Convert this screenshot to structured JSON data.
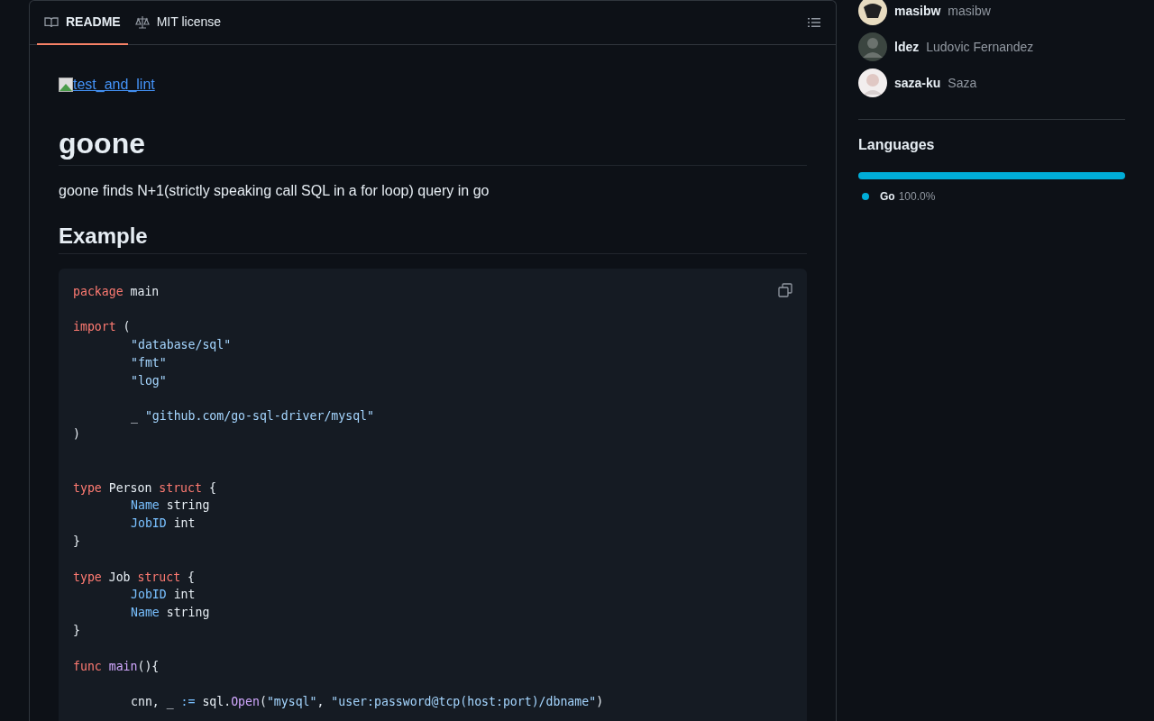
{
  "tabs": [
    {
      "label": "README",
      "selected": true
    },
    {
      "label": "MIT license",
      "selected": false
    }
  ],
  "readme": {
    "badge_alt": "test_and_lint",
    "title": "goone",
    "description": "goone finds N+1(strictly speaking call SQL in a for loop) query in go",
    "section": "Example",
    "code": [
      {
        "kind": "code",
        "indent": false,
        "tokens": [
          {
            "text": "package",
            "kind": "keyword"
          },
          {
            "text": " main",
            "kind": "plain"
          }
        ]
      },
      {
        "kind": "blank"
      },
      {
        "kind": "code",
        "indent": false,
        "tokens": [
          {
            "text": "import",
            "kind": "keyword"
          },
          {
            "text": " (",
            "kind": "plain"
          }
        ]
      },
      {
        "kind": "code",
        "indent": true,
        "tokens": [
          {
            "text": "\"database/sql\"",
            "kind": "string"
          }
        ]
      },
      {
        "kind": "code",
        "indent": true,
        "tokens": [
          {
            "text": "\"fmt\"",
            "kind": "string"
          }
        ]
      },
      {
        "kind": "code",
        "indent": true,
        "tokens": [
          {
            "text": "\"log\"",
            "kind": "string"
          }
        ]
      },
      {
        "kind": "blank"
      },
      {
        "kind": "code",
        "indent": true,
        "tokens": [
          {
            "text": "_ ",
            "kind": "plain"
          },
          {
            "text": "\"github.com/go-sql-driver/mysql\"",
            "kind": "string"
          }
        ]
      },
      {
        "kind": "code",
        "indent": false,
        "tokens": [
          {
            "text": ")",
            "kind": "plain"
          }
        ]
      },
      {
        "kind": "blank"
      },
      {
        "kind": "blank"
      },
      {
        "kind": "code",
        "indent": false,
        "tokens": [
          {
            "text": "type",
            "kind": "keyword"
          },
          {
            "text": " Person ",
            "kind": "plain"
          },
          {
            "text": "struct",
            "kind": "keyword"
          },
          {
            "text": " {",
            "kind": "plain"
          }
        ]
      },
      {
        "kind": "code",
        "indent": true,
        "tokens": [
          {
            "text": "Name",
            "kind": "field"
          },
          {
            "text": " string",
            "kind": "plain"
          }
        ]
      },
      {
        "kind": "code",
        "indent": true,
        "tokens": [
          {
            "text": "JobID",
            "kind": "field"
          },
          {
            "text": " int",
            "kind": "plain"
          }
        ]
      },
      {
        "kind": "code",
        "indent": false,
        "tokens": [
          {
            "text": "}",
            "kind": "plain"
          }
        ]
      },
      {
        "kind": "blank"
      },
      {
        "kind": "code",
        "indent": false,
        "tokens": [
          {
            "text": "type",
            "kind": "keyword"
          },
          {
            "text": " Job ",
            "kind": "plain"
          },
          {
            "text": "struct",
            "kind": "keyword"
          },
          {
            "text": " {",
            "kind": "plain"
          }
        ]
      },
      {
        "kind": "code",
        "indent": true,
        "tokens": [
          {
            "text": "JobID",
            "kind": "field"
          },
          {
            "text": " int",
            "kind": "plain"
          }
        ]
      },
      {
        "kind": "code",
        "indent": true,
        "tokens": [
          {
            "text": "Name",
            "kind": "field"
          },
          {
            "text": " string",
            "kind": "plain"
          }
        ]
      },
      {
        "kind": "code",
        "indent": false,
        "tokens": [
          {
            "text": "}",
            "kind": "plain"
          }
        ]
      },
      {
        "kind": "blank"
      },
      {
        "kind": "code",
        "indent": false,
        "tokens": [
          {
            "text": "func",
            "kind": "keyword"
          },
          {
            "text": " main",
            "kind": "function"
          },
          {
            "text": "(){",
            "kind": "plain"
          }
        ]
      },
      {
        "kind": "blank"
      },
      {
        "kind": "code",
        "indent": true,
        "tokens": [
          {
            "text": "cnn, _ ",
            "kind": "plain"
          },
          {
            "text": ":=",
            "kind": "field"
          },
          {
            "text": " sql.",
            "kind": "plain"
          },
          {
            "text": "Open",
            "kind": "function"
          },
          {
            "text": "(",
            "kind": "plain"
          },
          {
            "text": "\"mysql\"",
            "kind": "string"
          },
          {
            "text": ", ",
            "kind": "plain"
          },
          {
            "text": "\"user:password@tcp(host:port)/dbname\"",
            "kind": "string"
          },
          {
            "text": ")",
            "kind": "plain"
          }
        ]
      }
    ]
  },
  "contributors": [
    {
      "login": "masibw",
      "name": "masibw"
    },
    {
      "login": "ldez",
      "name": "Ludovic Fernandez"
    },
    {
      "login": "saza-ku",
      "name": "Saza"
    }
  ],
  "languages": {
    "title": "Languages",
    "items": [
      {
        "name": "Go",
        "percent": "100.0%",
        "level": 1.0,
        "color": "#00add8"
      }
    ]
  }
}
